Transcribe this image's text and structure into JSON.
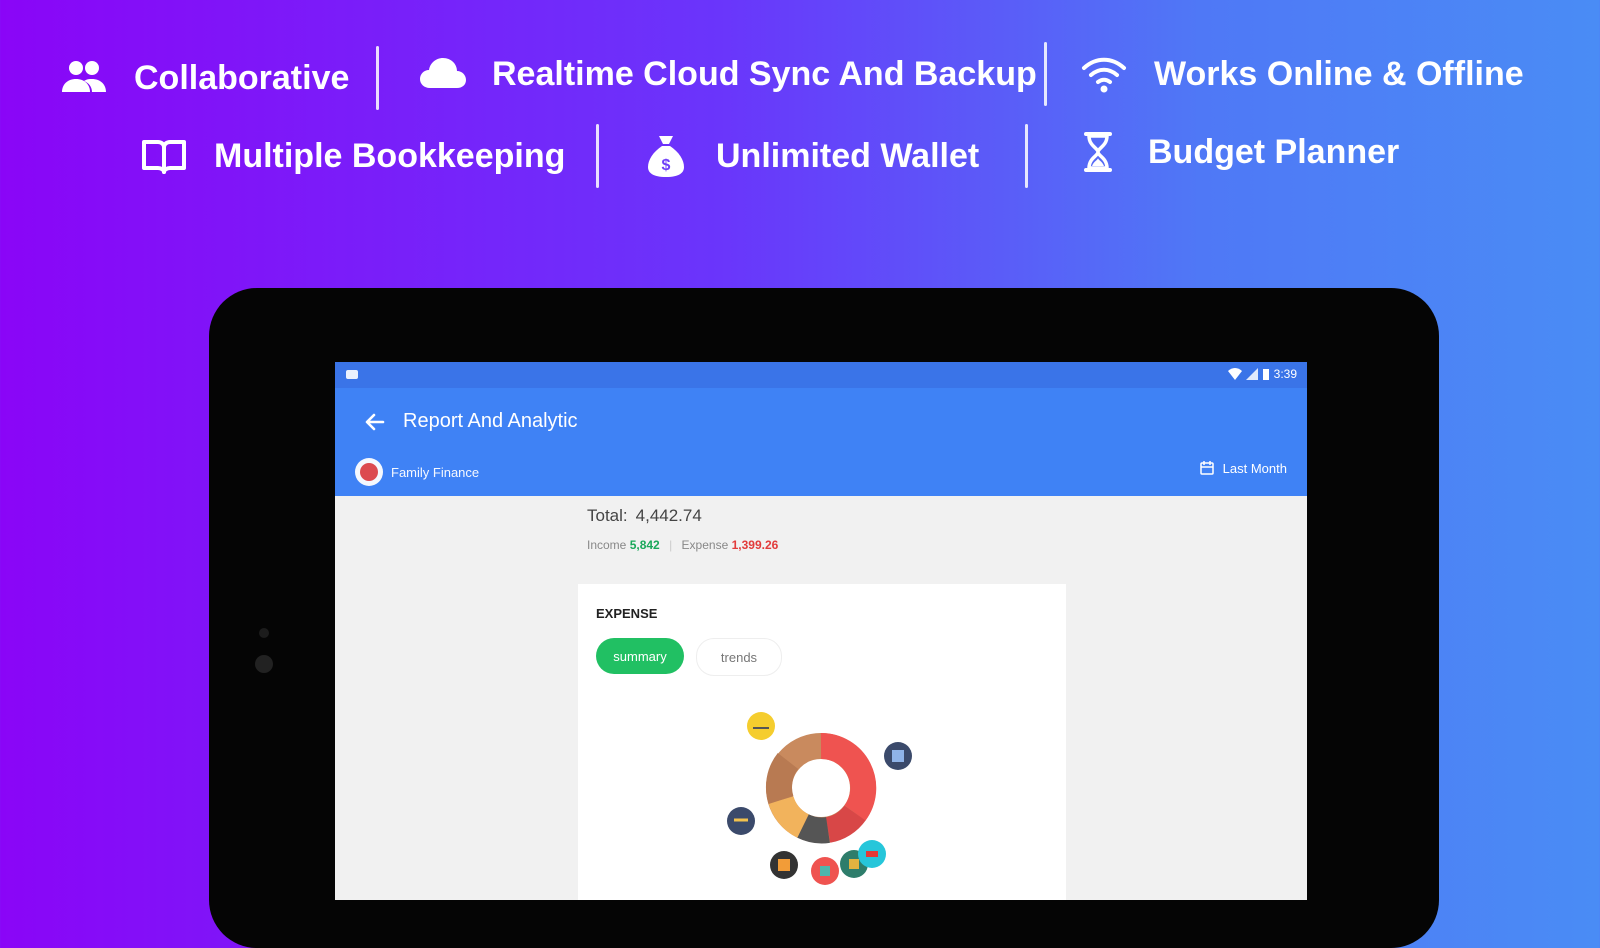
{
  "features": [
    {
      "icon": "users-icon",
      "label": "Collaborative"
    },
    {
      "icon": "cloud-icon",
      "label": "Realtime Cloud Sync And Backup"
    },
    {
      "icon": "wifi-icon",
      "label": "Works Online & Offline"
    },
    {
      "icon": "book-icon",
      "label": "Multiple Bookkeeping"
    },
    {
      "icon": "money-bag-icon",
      "label": "Unlimited Wallet"
    },
    {
      "icon": "hourglass-icon",
      "label": "Budget Planner"
    }
  ],
  "device": {
    "status_bar": {
      "time": "3:39"
    },
    "app_bar": {
      "title": "Report And Analytic",
      "book_name": "Family Finance",
      "period": "Last Month"
    },
    "summary": {
      "total_label": "Total:",
      "total_value": "4,442.74",
      "income_label": "Income",
      "income_value": "5,842",
      "expense_label": "Expense",
      "expense_value": "1,399.26"
    },
    "card": {
      "header": "EXPENSE",
      "tabs": [
        "summary",
        "trends"
      ],
      "active_tab": "summary"
    }
  },
  "colors": {
    "accent": "#3f82f5",
    "income": "#1aa85a",
    "expense": "#e23b3b",
    "active_tab": "#21c063"
  }
}
